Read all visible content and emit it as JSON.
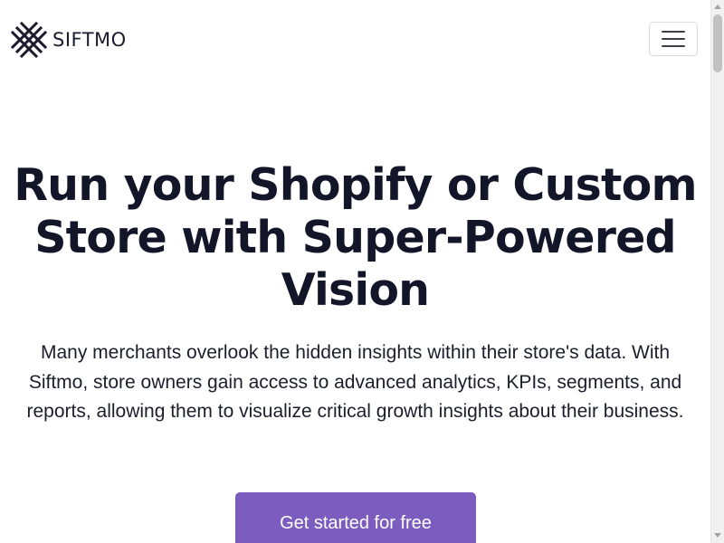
{
  "navbar": {
    "brand_name": "SIFTMO",
    "logo_icon": "grid-mesh-logo-icon",
    "menu_icon": "hamburger-menu-icon"
  },
  "hero": {
    "title_lines": [
      "Run your Shopify or Custom",
      "Store with Super-Powered",
      "Vision"
    ],
    "description": "Many merchants overlook the hidden insights within their store's data. With Siftmo, store owners gain access to advanced analytics, KPIs, segments, and reports, allowing them to visualize critical growth insights about their business.",
    "cta_label": "Get started for free"
  },
  "colors": {
    "text_dark": "#131629",
    "cta_background": "#7c5cbf",
    "cta_text": "#ffffff"
  }
}
